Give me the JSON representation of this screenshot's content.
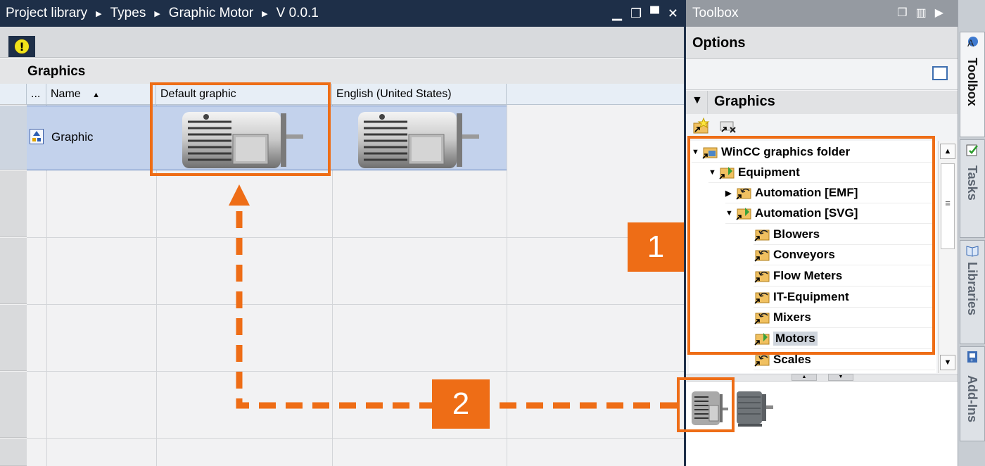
{
  "editor": {
    "breadcrumb": [
      "Project library",
      "Types",
      "Graphic Motor",
      "V 0.0.1"
    ],
    "window_controls": [
      "▁",
      "❐",
      "▀",
      "✕"
    ],
    "warning_glyph": "!",
    "section_title": "Graphics",
    "columns": {
      "dots": "...",
      "name": "Name",
      "default_graphic": "Default graphic",
      "english": "English (United States)"
    },
    "rows": [
      {
        "name": "Graphic"
      }
    ]
  },
  "toolbox": {
    "title": "Toolbox",
    "options_title": "Options",
    "graphics_title": "Graphics",
    "tree": [
      {
        "label": "WinCC graphics folder",
        "level": 0,
        "expanded": true
      },
      {
        "label": "Equipment",
        "level": 1,
        "expanded": true
      },
      {
        "label": "Automation [EMF]",
        "level": 2,
        "expanded": false
      },
      {
        "label": "Automation [SVG]",
        "level": 2,
        "expanded": true
      },
      {
        "label": "Blowers",
        "level": 3
      },
      {
        "label": "Conveyors",
        "level": 3
      },
      {
        "label": "Flow Meters",
        "level": 3
      },
      {
        "label": "IT-Equipment",
        "level": 3
      },
      {
        "label": "Mixers",
        "level": 3
      },
      {
        "label": "Motors",
        "level": 3,
        "selected": true
      },
      {
        "label": "Scales",
        "level": 3
      }
    ],
    "scroll_grip": "≡"
  },
  "side_tabs": [
    "Toolbox",
    "Tasks",
    "Libraries",
    "Add-Ins"
  ],
  "annotations": {
    "badge_1": "1",
    "badge_2": "2",
    "accent_color": "#ee6d16"
  }
}
